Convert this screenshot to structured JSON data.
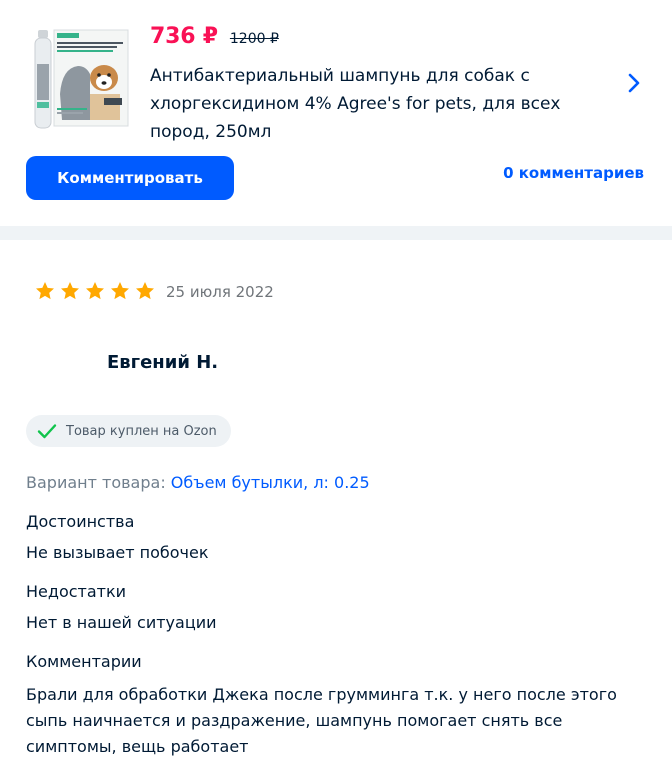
{
  "product": {
    "price_current": "736 ₽",
    "price_old": "1200 ₽",
    "title": "Антибактериальный шампунь для собак с хлоргексидином 4% Agree's for pets, для всех пород, 250мл",
    "thumbnail_icon": "product-bottle-image",
    "comment_button_label": "Комментировать",
    "comments_count_link": "0 комментариев"
  },
  "colors": {
    "accent_blue": "#005bff",
    "price_red": "#f91155",
    "star_gold": "#ffa800",
    "check_green": "#10c44c"
  },
  "review": {
    "rating": 5,
    "rating_max": 5,
    "date": "25 июля 2022",
    "author": "Евгений Н.",
    "badge": "Товар куплен на Ozon",
    "variant_label": "Вариант товара:",
    "variant_value": "Объем бутылки, л: 0.25",
    "pros_label": "Достоинства",
    "pros_text": "Не вызывает побочек",
    "cons_label": "Недостатки",
    "cons_text": "Нет в нашей ситуации",
    "comment_label": "Комментарии",
    "comment_text": "Брали для обработки Джека после грумминга т.к. у него после этого сыпь наичнается и раздражение, шампунь помогает снять все симптомы, вещь работает"
  }
}
